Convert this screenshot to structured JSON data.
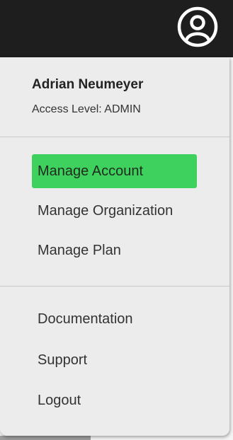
{
  "user": {
    "name": "Adrian Neumeyer",
    "access_level": "Access Level: ADMIN"
  },
  "account_menu": [
    {
      "label": "Manage Account",
      "active": true
    },
    {
      "label": "Manage Organization",
      "active": false
    },
    {
      "label": "Manage Plan",
      "active": false
    }
  ],
  "help_menu": [
    {
      "label": "Documentation"
    },
    {
      "label": "Support"
    },
    {
      "label": "Logout"
    }
  ],
  "icons": {
    "avatar": "user-circle-icon"
  },
  "colors": {
    "topbar": "#1e1e1e",
    "menu_background": "#ececec",
    "active_highlight": "#3ed15d"
  }
}
